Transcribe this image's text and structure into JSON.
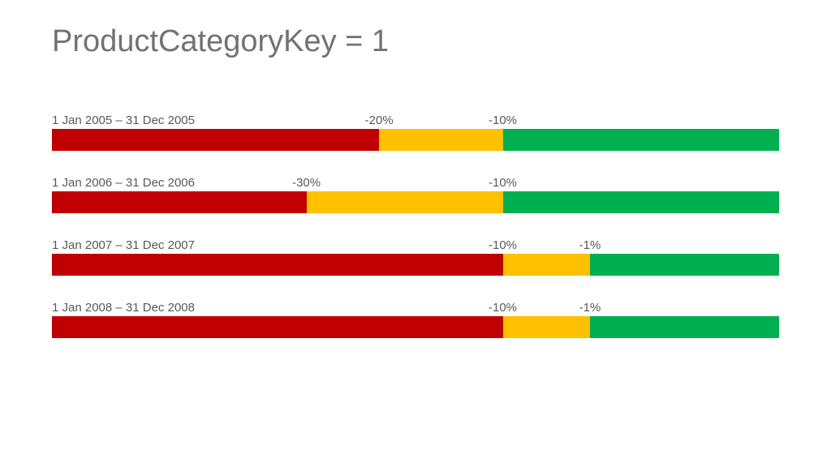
{
  "title": "ProductCategoryKey = 1",
  "colors": {
    "red": "#c00000",
    "yellow": "#ffc000",
    "green": "#00b050"
  },
  "chart_data": {
    "type": "bar",
    "title": "ProductCategoryKey = 1",
    "xlabel": "",
    "ylabel": "",
    "categories": [
      "1 Jan 2005 – 31 Dec 2005",
      "1 Jan 2006 – 31 Dec 2006",
      "1 Jan 2007 – 31 Dec 2007",
      "1 Jan 2008 – 31 Dec 2008"
    ],
    "series": [
      {
        "name": "red_end_pct",
        "values": [
          45,
          35,
          62,
          62
        ]
      },
      {
        "name": "yellow_end_pct",
        "values": [
          62,
          62,
          74,
          74
        ]
      },
      {
        "name": "green_end_pct",
        "values": [
          100,
          100,
          100,
          100
        ]
      }
    ],
    "threshold_labels": [
      {
        "red_yellow": "-20%",
        "yellow_green": "-10%"
      },
      {
        "red_yellow": "-30%",
        "yellow_green": "-10%"
      },
      {
        "red_yellow": "-10%",
        "yellow_green": "-1%"
      },
      {
        "red_yellow": "-10%",
        "yellow_green": "-1%"
      }
    ]
  },
  "rows": [
    {
      "period": "1 Jan 2005 – 31 Dec 2005",
      "t1": "-20%",
      "t2": "-10%",
      "red": 45,
      "yellow": 17,
      "green": 38
    },
    {
      "period": "1 Jan 2006 – 31 Dec 2006",
      "t1": "-30%",
      "t2": "-10%",
      "red": 35,
      "yellow": 27,
      "green": 38
    },
    {
      "period": "1 Jan 2007 – 31 Dec 2007",
      "t1": "-10%",
      "t2": "-1%",
      "red": 62,
      "yellow": 12,
      "green": 26
    },
    {
      "period": "1 Jan 2008 – 31 Dec 2008",
      "t1": "-10%",
      "t2": "-1%",
      "red": 62,
      "yellow": 12,
      "green": 26
    }
  ]
}
